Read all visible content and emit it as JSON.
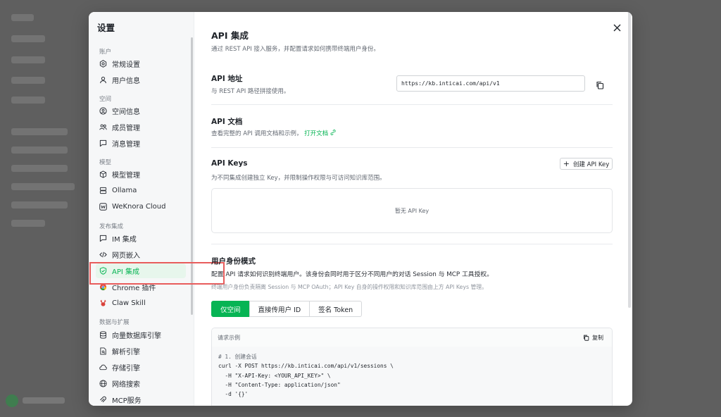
{
  "settings": {
    "title": "设置",
    "sections": [
      {
        "label": "账户",
        "items": [
          {
            "label": "常规设置",
            "icon": "gear-icon"
          },
          {
            "label": "用户信息",
            "icon": "user-icon"
          }
        ]
      },
      {
        "label": "空间",
        "items": [
          {
            "label": "空间信息",
            "icon": "user-circle-icon"
          },
          {
            "label": "成员管理",
            "icon": "users-icon"
          },
          {
            "label": "消息管理",
            "icon": "message-icon"
          }
        ]
      },
      {
        "label": "模型",
        "items": [
          {
            "label": "模型管理",
            "icon": "cube-icon"
          },
          {
            "label": "Ollama",
            "icon": "server-icon"
          },
          {
            "label": "WeKnora Cloud",
            "icon": "weknora-logo-icon"
          }
        ]
      },
      {
        "label": "发布集成",
        "items": [
          {
            "label": "IM 集成",
            "icon": "chat-icon"
          },
          {
            "label": "网页嵌入",
            "icon": "code-icon"
          },
          {
            "label": "API 集成",
            "icon": "shield-check-icon",
            "active": true
          },
          {
            "label": "Chrome 插件",
            "icon": "chrome-icon"
          },
          {
            "label": "Claw Skill",
            "icon": "claw-icon"
          }
        ]
      },
      {
        "label": "数据与扩展",
        "items": [
          {
            "label": "向量数据库引擎",
            "icon": "database-icon"
          },
          {
            "label": "解析引擎",
            "icon": "file-parse-icon"
          },
          {
            "label": "存储引擎",
            "icon": "cloud-icon"
          },
          {
            "label": "网络搜索",
            "icon": "globe-icon"
          },
          {
            "label": "MCP服务",
            "icon": "mcp-icon"
          }
        ]
      }
    ]
  },
  "api": {
    "title": "API 集成",
    "subtitle": "通过 REST API 接入服务，并配置请求如何携带终端用户身份。",
    "address": {
      "title": "API 地址",
      "desc": "与 REST API 路径拼接使用。",
      "url": "https://kb.inticai.com/api/v1"
    },
    "docs": {
      "title": "API 文档",
      "desc": "查看完整的 API 调用文档和示例，",
      "link": "打开文档"
    },
    "keys": {
      "title": "API Keys",
      "desc": "为不同集成创建独立 Key，并限制操作权限与可访问知识库范围。",
      "create_label": "创建 API Key",
      "empty": "暂无 API Key"
    },
    "identity": {
      "title": "用户身份模式",
      "desc": "配置 API 请求如何识别终端用户。该身份会同时用于区分不同用户的对话 Session 与 MCP 工具授权。",
      "note": "终端用户身份负责隔离 Session 与 MCP OAuth；API Key 自身的操作权限和知识库范围由上方 API Keys 管理。",
      "tabs": [
        "仅空间",
        "直接传用户 ID",
        "签名 Token"
      ],
      "active_tab": 0
    },
    "example": {
      "title": "请求示例",
      "copy_label": "复制",
      "lines": [
        "# 1. 创建会话",
        "curl -X POST https://kb.inticai.com/api/v1/sessions \\",
        "  -H \"X-API-Key: <YOUR_API_KEY>\" \\",
        "  -H \"Content-Type: application/json\"",
        "  -d '{}'"
      ]
    }
  },
  "colors": {
    "accent": "#07b454",
    "highlight_border": "#e85c5c"
  }
}
